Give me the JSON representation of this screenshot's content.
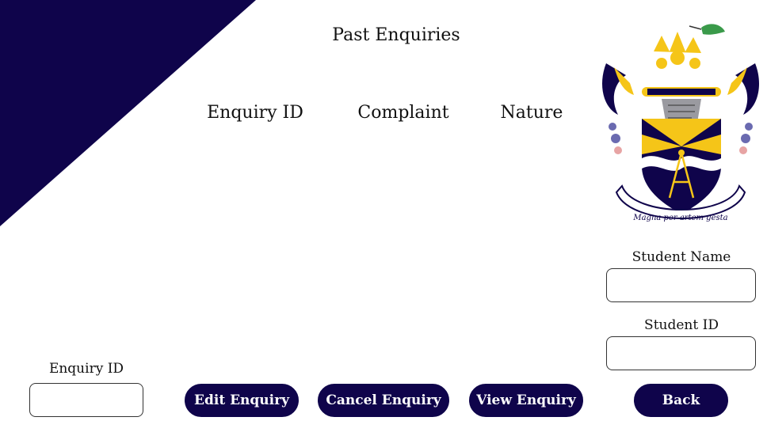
{
  "page": {
    "title": "Past Enquiries"
  },
  "table": {
    "columns": [
      "Enquiry ID",
      "Complaint",
      "Nature"
    ]
  },
  "crest": {
    "motto": "Magna per artem gesta"
  },
  "form": {
    "student_name_label": "Student Name",
    "student_name_value": "",
    "student_id_label": "Student ID",
    "student_id_value": "",
    "enquiry_id_label": "Enquiry ID",
    "enquiry_id_value": ""
  },
  "buttons": {
    "edit": "Edit Enquiry",
    "cancel": "Cancel Enquiry",
    "view": "View Enquiry",
    "back": "Back"
  },
  "colors": {
    "navy": "#0f044b",
    "gold": "#f5c518",
    "background": "#ffffff"
  }
}
